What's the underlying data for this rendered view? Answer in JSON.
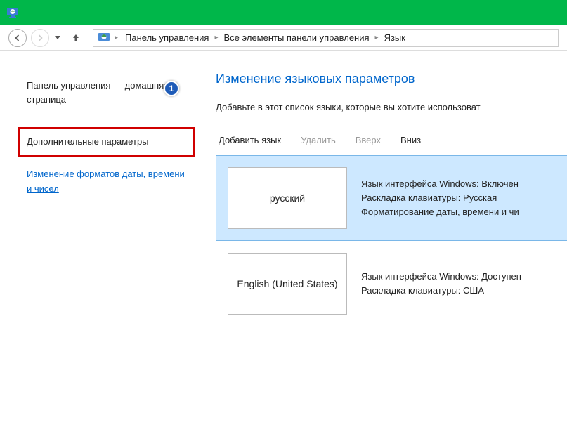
{
  "breadcrumbs": [
    "Панель управления",
    "Все элементы панели управления",
    "Язык"
  ],
  "sidebar": {
    "home": "Панель управления — домашняя страница",
    "badge": "1",
    "advanced": "Дополнительные параметры",
    "dateformat": "Изменение форматов даты, времени и чисел"
  },
  "main": {
    "title": "Изменение языковых параметров",
    "desc": "Добавьте в этот список языки, которые вы хотите использоват"
  },
  "toolbar": {
    "add": "Добавить язык",
    "remove": "Удалить",
    "up": "Вверх",
    "down": "Вниз"
  },
  "languages": [
    {
      "name": "русский",
      "selected": true,
      "lines": [
        "Язык интерфейса Windows: Включен",
        "Раскладка клавиатуры: Русская",
        "Форматирование даты, времени и чи"
      ]
    },
    {
      "name": "English (United States)",
      "selected": false,
      "lines": [
        "Язык интерфейса Windows: Доступен",
        "Раскладка клавиатуры: США"
      ]
    }
  ]
}
